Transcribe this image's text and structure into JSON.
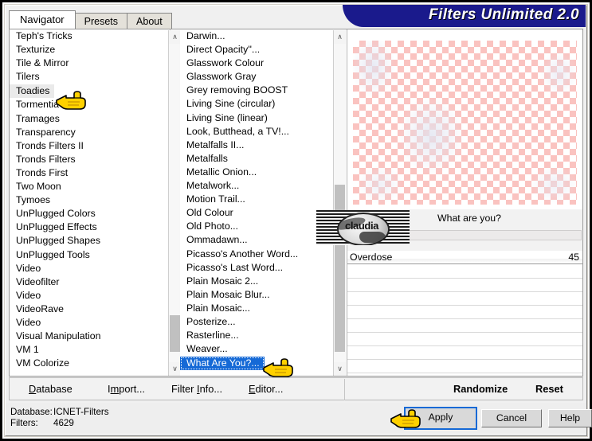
{
  "window": {
    "banner_title": "Filters Unlimited 2.0",
    "banner_color": "#1a1a8c"
  },
  "tabs": [
    {
      "label": "Navigator",
      "active": true
    },
    {
      "label": "Presets",
      "active": false
    },
    {
      "label": "About",
      "active": false
    }
  ],
  "category_list": {
    "name": "filter-category-list",
    "hovered": "Toadies",
    "items": [
      "Teph's Tricks",
      "Texturize",
      "Tile & Mirror",
      "Tilers",
      "Toadies",
      "Tormentia",
      "Tramages",
      "Transparency",
      "Tronds Filters II",
      "Tronds Filters",
      "Tronds First",
      "Two Moon",
      "Tymoes",
      "UnPlugged Colors",
      "UnPlugged Effects",
      "UnPlugged Shapes",
      "UnPlugged Tools",
      "Video",
      "Videofilter",
      "Video",
      "VideoRave",
      "Video",
      "Visual Manipulation",
      "VM 1",
      "VM Colorize"
    ]
  },
  "filter_list": {
    "name": "filter-effect-list",
    "selected": "What Are You?...",
    "items": [
      "Darwin...",
      "Direct Opacity''...",
      "Glasswork Colour",
      "Glasswork Gray",
      "Grey removing BOOST",
      "Living Sine (circular)",
      "Living Sine (linear)",
      "Look, Butthead, a TV!...",
      "Metalfalls II...",
      "Metalfalls",
      "Metallic Onion...",
      "Metalwork...",
      "Motion Trail...",
      "Old Colour",
      "Old Photo...",
      "Ommadawn...",
      "Picasso's Another Word...",
      "Picasso's Last Word...",
      "Plain Mosaic 2...",
      "Plain Mosaic Blur...",
      "Plain Mosaic...",
      "Posterize...",
      "Rasterline...",
      "Weaver...",
      "What Are You?..."
    ]
  },
  "parameters": {
    "title": "What are you?",
    "sliders": [
      {
        "label": "Overdose",
        "value": "45"
      }
    ]
  },
  "watermark": {
    "text": "claudia"
  },
  "menubar": {
    "items": [
      {
        "pre": "",
        "accel": "D",
        "post": "atabase"
      },
      {
        "pre": "I",
        "accel": "m",
        "post": "port..."
      },
      {
        "pre": "Filter ",
        "accel": "I",
        "post": "nfo..."
      },
      {
        "pre": "",
        "accel": "E",
        "post": "ditor..."
      }
    ],
    "right_items": [
      "Randomize",
      "Reset"
    ]
  },
  "status": {
    "database_key": "Database:",
    "database_value": "ICNET-Filters",
    "filters_key": "Filters:",
    "filters_value": "4629"
  },
  "buttons": {
    "apply": "Apply",
    "cancel": "Cancel",
    "help": "Help"
  },
  "scrollbars": {
    "up_glyph": "∧",
    "down_glyph": "∨"
  }
}
